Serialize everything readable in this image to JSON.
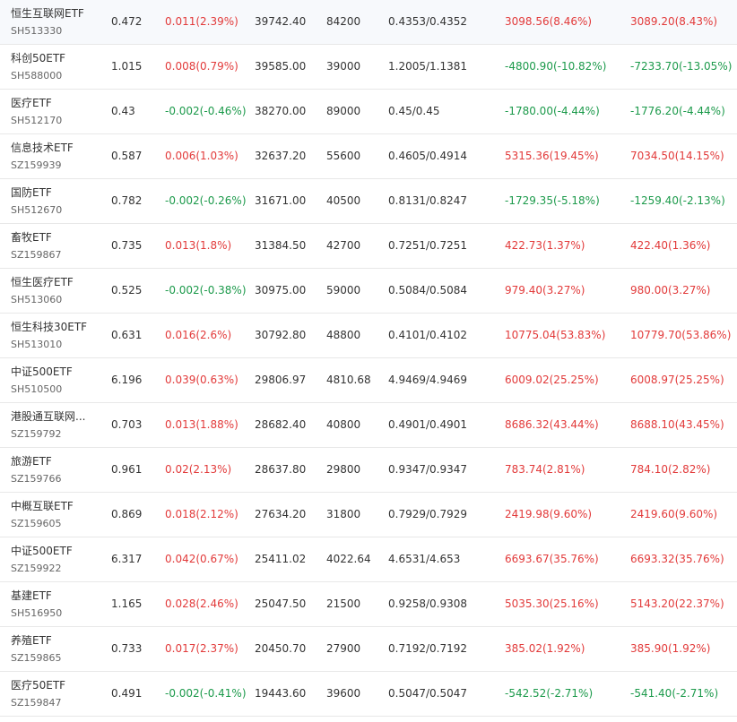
{
  "colors": {
    "up": "#e23a3a",
    "down": "#1c9a4b",
    "text": "#333333",
    "subtext": "#666666",
    "divider": "#e8e8e8"
  },
  "rows": [
    {
      "name": "恒生互联网ETF",
      "code": "SH513330",
      "price": "0.472",
      "change": "0.011(2.39%)",
      "turnover": "39742.40",
      "volume": "84200",
      "bid_ask": "0.4353/0.4352",
      "pnl_1": "3098.56(8.46%)",
      "pnl_2": "3089.20(8.43%)",
      "change_dir": "up",
      "pnl_1_dir": "up",
      "pnl_2_dir": "up"
    },
    {
      "name": "科创50ETF",
      "code": "SH588000",
      "price": "1.015",
      "change": "0.008(0.79%)",
      "turnover": "39585.00",
      "volume": "39000",
      "bid_ask": "1.2005/1.1381",
      "pnl_1": "-4800.90(-10.82%)",
      "pnl_2": "-7233.70(-13.05%)",
      "change_dir": "up",
      "pnl_1_dir": "down",
      "pnl_2_dir": "down"
    },
    {
      "name": "医疗ETF",
      "code": "SH512170",
      "price": "0.43",
      "change": "-0.002(-0.46%)",
      "turnover": "38270.00",
      "volume": "89000",
      "bid_ask": "0.45/0.45",
      "pnl_1": "-1780.00(-4.44%)",
      "pnl_2": "-1776.20(-4.44%)",
      "change_dir": "down",
      "pnl_1_dir": "down",
      "pnl_2_dir": "down"
    },
    {
      "name": "信息技术ETF",
      "code": "SZ159939",
      "price": "0.587",
      "change": "0.006(1.03%)",
      "turnover": "32637.20",
      "volume": "55600",
      "bid_ask": "0.4605/0.4914",
      "pnl_1": "5315.36(19.45%)",
      "pnl_2": "7034.50(14.15%)",
      "change_dir": "up",
      "pnl_1_dir": "up",
      "pnl_2_dir": "up"
    },
    {
      "name": "国防ETF",
      "code": "SH512670",
      "price": "0.782",
      "change": "-0.002(-0.26%)",
      "turnover": "31671.00",
      "volume": "40500",
      "bid_ask": "0.8131/0.8247",
      "pnl_1": "-1729.35(-5.18%)",
      "pnl_2": "-1259.40(-2.13%)",
      "change_dir": "down",
      "pnl_1_dir": "down",
      "pnl_2_dir": "down"
    },
    {
      "name": "畜牧ETF",
      "code": "SZ159867",
      "price": "0.735",
      "change": "0.013(1.8%)",
      "turnover": "31384.50",
      "volume": "42700",
      "bid_ask": "0.7251/0.7251",
      "pnl_1": "422.73(1.37%)",
      "pnl_2": "422.40(1.36%)",
      "change_dir": "up",
      "pnl_1_dir": "up",
      "pnl_2_dir": "up"
    },
    {
      "name": "恒生医疗ETF",
      "code": "SH513060",
      "price": "0.525",
      "change": "-0.002(-0.38%)",
      "turnover": "30975.00",
      "volume": "59000",
      "bid_ask": "0.5084/0.5084",
      "pnl_1": "979.40(3.27%)",
      "pnl_2": "980.00(3.27%)",
      "change_dir": "down",
      "pnl_1_dir": "up",
      "pnl_2_dir": "up"
    },
    {
      "name": "恒生科技30ETF",
      "code": "SH513010",
      "price": "0.631",
      "change": "0.016(2.6%)",
      "turnover": "30792.80",
      "volume": "48800",
      "bid_ask": "0.4101/0.4102",
      "pnl_1": "10775.04(53.83%)",
      "pnl_2": "10779.70(53.86%)",
      "change_dir": "up",
      "pnl_1_dir": "up",
      "pnl_2_dir": "up"
    },
    {
      "name": "中证500ETF",
      "code": "SH510500",
      "price": "6.196",
      "change": "0.039(0.63%)",
      "turnover": "29806.97",
      "volume": "4810.68",
      "bid_ask": "4.9469/4.9469",
      "pnl_1": "6009.02(25.25%)",
      "pnl_2": "6008.97(25.25%)",
      "change_dir": "up",
      "pnl_1_dir": "up",
      "pnl_2_dir": "up"
    },
    {
      "name": "港股通互联网...",
      "code": "SZ159792",
      "price": "0.703",
      "change": "0.013(1.88%)",
      "turnover": "28682.40",
      "volume": "40800",
      "bid_ask": "0.4901/0.4901",
      "pnl_1": "8686.32(43.44%)",
      "pnl_2": "8688.10(43.45%)",
      "change_dir": "up",
      "pnl_1_dir": "up",
      "pnl_2_dir": "up"
    },
    {
      "name": "旅游ETF",
      "code": "SZ159766",
      "price": "0.961",
      "change": "0.02(2.13%)",
      "turnover": "28637.80",
      "volume": "29800",
      "bid_ask": "0.9347/0.9347",
      "pnl_1": "783.74(2.81%)",
      "pnl_2": "784.10(2.82%)",
      "change_dir": "up",
      "pnl_1_dir": "up",
      "pnl_2_dir": "up"
    },
    {
      "name": "中概互联ETF",
      "code": "SZ159605",
      "price": "0.869",
      "change": "0.018(2.12%)",
      "turnover": "27634.20",
      "volume": "31800",
      "bid_ask": "0.7929/0.7929",
      "pnl_1": "2419.98(9.60%)",
      "pnl_2": "2419.60(9.60%)",
      "change_dir": "up",
      "pnl_1_dir": "up",
      "pnl_2_dir": "up"
    },
    {
      "name": "中证500ETF",
      "code": "SZ159922",
      "price": "6.317",
      "change": "0.042(0.67%)",
      "turnover": "25411.02",
      "volume": "4022.64",
      "bid_ask": "4.6531/4.653",
      "pnl_1": "6693.67(35.76%)",
      "pnl_2": "6693.32(35.76%)",
      "change_dir": "up",
      "pnl_1_dir": "up",
      "pnl_2_dir": "up"
    },
    {
      "name": "基建ETF",
      "code": "SH516950",
      "price": "1.165",
      "change": "0.028(2.46%)",
      "turnover": "25047.50",
      "volume": "21500",
      "bid_ask": "0.9258/0.9308",
      "pnl_1": "5035.30(25.16%)",
      "pnl_2": "5143.20(22.37%)",
      "change_dir": "up",
      "pnl_1_dir": "up",
      "pnl_2_dir": "up"
    },
    {
      "name": "养殖ETF",
      "code": "SZ159865",
      "price": "0.733",
      "change": "0.017(2.37%)",
      "turnover": "20450.70",
      "volume": "27900",
      "bid_ask": "0.7192/0.7192",
      "pnl_1": "385.02(1.92%)",
      "pnl_2": "385.90(1.92%)",
      "change_dir": "up",
      "pnl_1_dir": "up",
      "pnl_2_dir": "up"
    },
    {
      "name": "医疗50ETF",
      "code": "SZ159847",
      "price": "0.491",
      "change": "-0.002(-0.41%)",
      "turnover": "19443.60",
      "volume": "39600",
      "bid_ask": "0.5047/0.5047",
      "pnl_1": "-542.52(-2.71%)",
      "pnl_2": "-541.40(-2.71%)",
      "change_dir": "down",
      "pnl_1_dir": "down",
      "pnl_2_dir": "down"
    }
  ]
}
